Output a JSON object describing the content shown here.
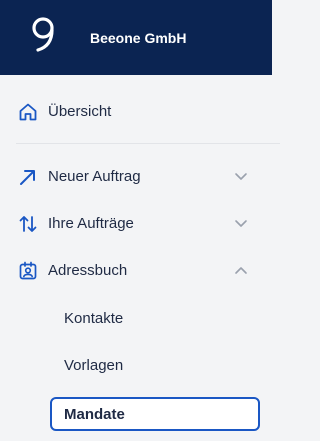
{
  "header": {
    "company_name": "Beeone GmbH",
    "logo_icon": "beeone-logo"
  },
  "nav": {
    "overview": {
      "label": "Übersicht",
      "icon": "home-icon"
    },
    "new_order": {
      "label": "Neuer Auftrag",
      "icon": "arrow-up-right-icon"
    },
    "my_orders": {
      "label": "Ihre Aufträge",
      "icon": "swap-vertical-icon"
    },
    "address_book": {
      "label": "Adressbuch",
      "icon": "contact-book-icon",
      "expanded": true,
      "children": [
        {
          "label": "Kontakte"
        },
        {
          "label": "Vorlagen"
        },
        {
          "label": "Mandate",
          "active": true
        }
      ]
    }
  },
  "colors": {
    "header_bg": "#0b2452",
    "accent": "#1a57c4",
    "sidebar_bg": "#f3f4f6"
  }
}
